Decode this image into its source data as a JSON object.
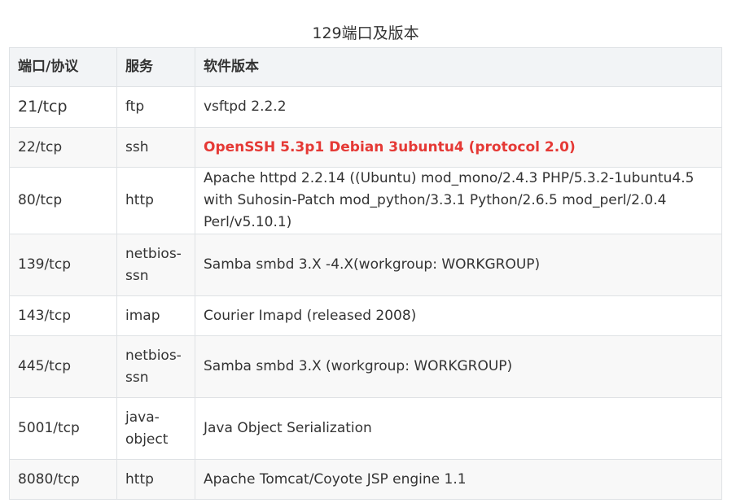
{
  "caption": "129端口及版本",
  "headers": [
    "端口/协议",
    "服务",
    "软件版本"
  ],
  "rows": [
    {
      "port": "21/tcp",
      "service": "ftp",
      "version": "vsftpd 2.2.2"
    },
    {
      "port": "22/tcp",
      "service": "ssh",
      "version": "OpenSSH 5.3p1 Debian 3ubuntu4 (protocol 2.0)",
      "highlight": true
    },
    {
      "port": "80/tcp",
      "service": "http",
      "version": "Apache httpd 2.2.14 ((Ubuntu) mod_mono/2.4.3 PHP/5.3.2-1ubuntu4.5 with Suhosin-Patch mod_python/3.3.1 Python/2.6.5 mod_perl/2.0.4 Perl/v5.10.1)"
    },
    {
      "port": "139/tcp",
      "service": "netbios-ssn",
      "version": "Samba smbd 3.X -4.X(workgroup: WORKGROUP)"
    },
    {
      "port": "143/tcp",
      "service": "imap",
      "version": "Courier Imapd (released 2008)"
    },
    {
      "port": "445/tcp",
      "service": "netbios-ssn",
      "version": "Samba smbd 3.X (workgroup: WORKGROUP)"
    },
    {
      "port": "5001/tcp",
      "service": "java-object",
      "version": "Java Object Serialization"
    },
    {
      "port": "8080/tcp",
      "service": "http",
      "version": "Apache Tomcat/Coyote JSP engine 1.1"
    }
  ],
  "colors": {
    "highlight": "#e53935",
    "header_bg": "#f2f4f6",
    "border": "#dfe2e5",
    "alt_row_bg": "#f8f8f8"
  }
}
